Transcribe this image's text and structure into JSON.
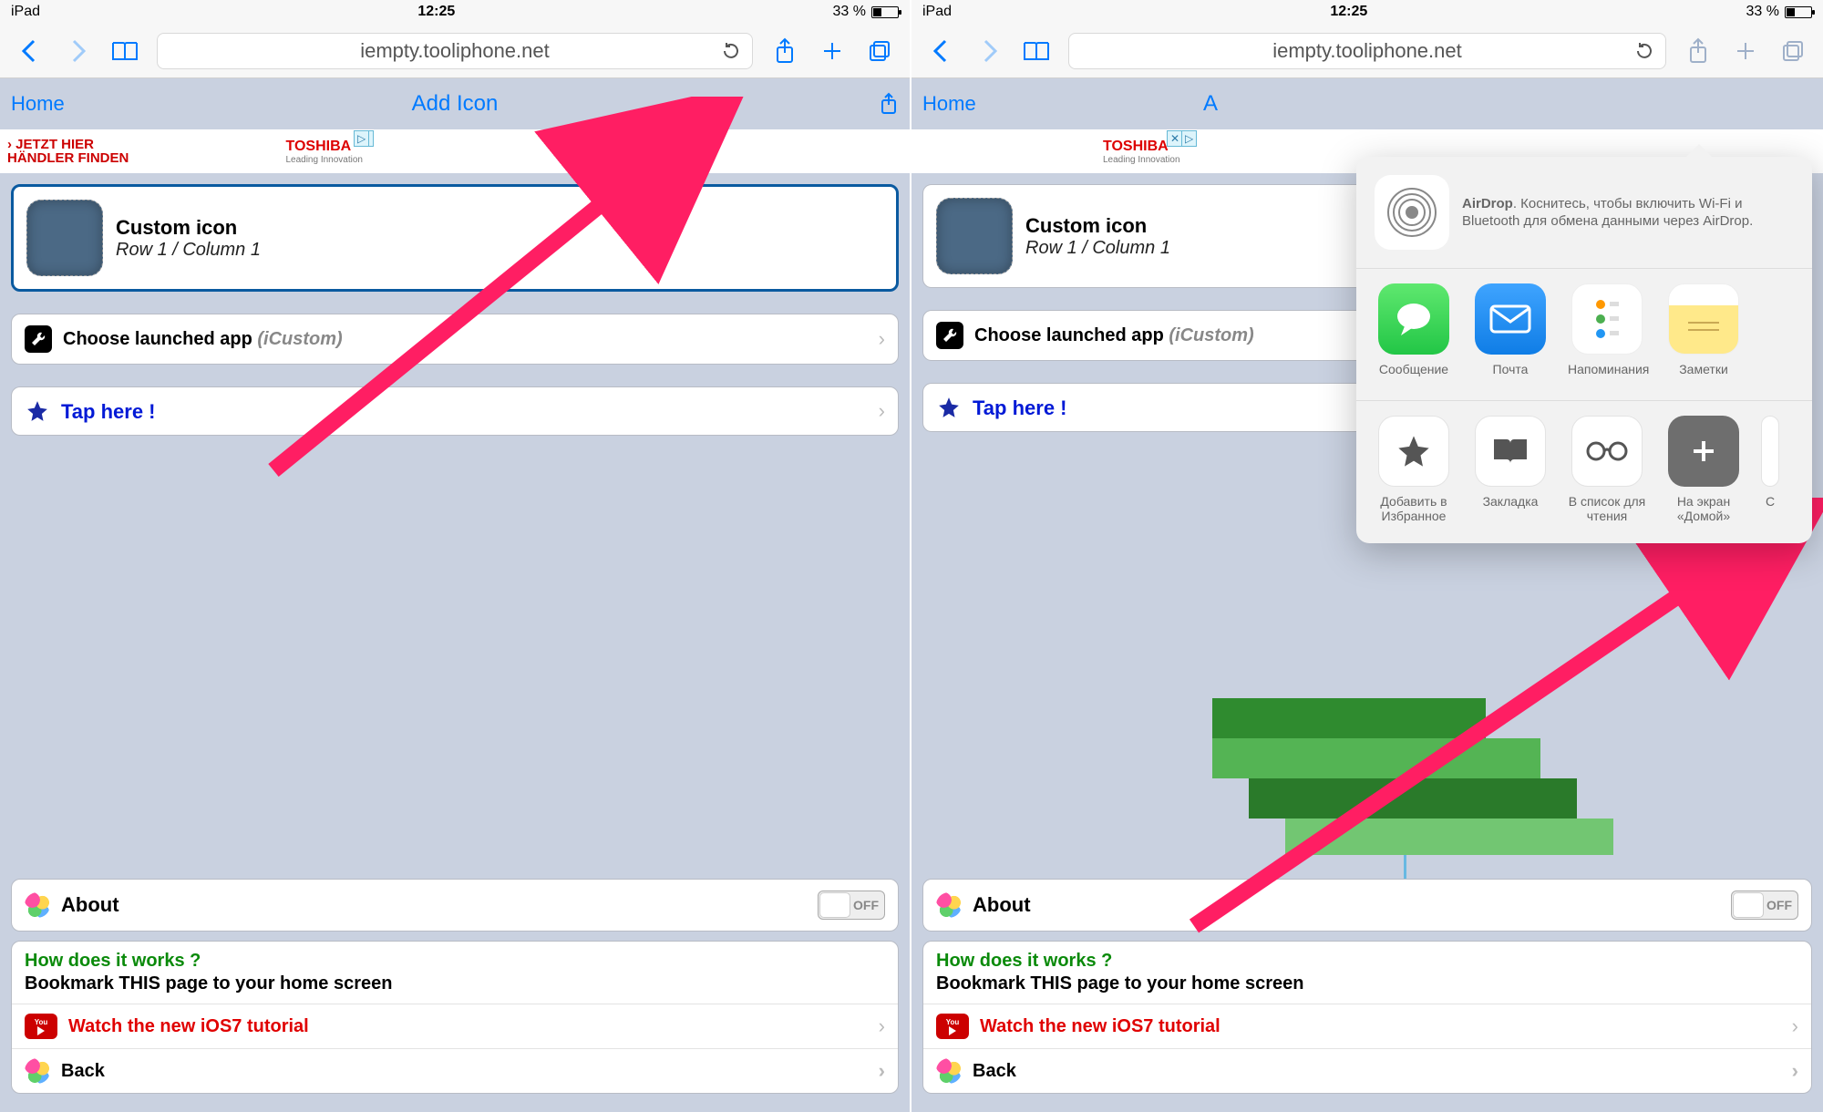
{
  "statusbar": {
    "device": "iPad",
    "time": "12:25",
    "battery_text": "33 %"
  },
  "toolbar": {
    "url": "iempty.tooliphone.net"
  },
  "page_nav": {
    "home": "Home",
    "title": "Add Icon"
  },
  "ad": {
    "line1": "› JETZT HIER",
    "line2": "HÄNDLER FINDEN",
    "brand": "TOSHIBA",
    "brand_sub": "Leading Innovation"
  },
  "custom_icon": {
    "title": "Custom icon",
    "subtitle": "Row 1 / Column 1"
  },
  "rows": {
    "launched_label": "Choose launched app",
    "launched_param": "(iCustom)",
    "tap_here": "Tap here !",
    "about": "About",
    "switch_off": "OFF",
    "how_title": "How does it works ?",
    "how_sub": "Bookmark THIS page to your home screen",
    "watch": "Watch the new iOS7 tutorial",
    "back": "Back"
  },
  "share_sheet": {
    "airdrop_title": "AirDrop",
    "airdrop_text": ". Коснитесь, чтобы включить Wi-Fi и Bluetooth для обмена данными через AirDrop.",
    "row1": [
      {
        "key": "messages",
        "label": "Сообщение"
      },
      {
        "key": "mail",
        "label": "Почта"
      },
      {
        "key": "reminders",
        "label": "Напоминания"
      },
      {
        "key": "notes",
        "label": "Заметки"
      }
    ],
    "row2": [
      {
        "key": "favorites",
        "label": "Добавить в Избранное"
      },
      {
        "key": "bookmark",
        "label": "Закладка"
      },
      {
        "key": "reading-list",
        "label": "В список для чтения"
      },
      {
        "key": "home-screen",
        "label": "На экран «Домой»"
      }
    ]
  },
  "right_pane_home_cutoff": "A"
}
